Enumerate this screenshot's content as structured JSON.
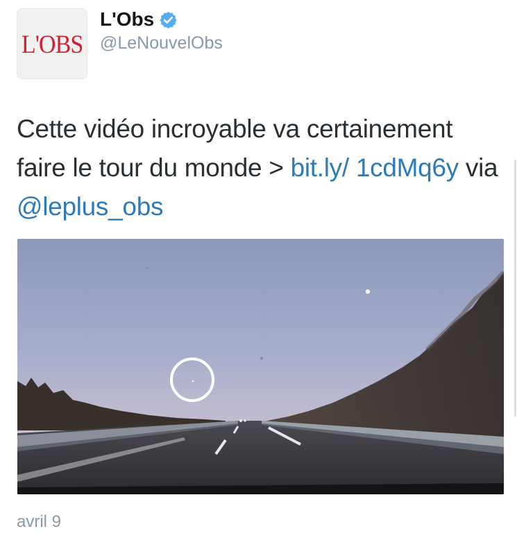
{
  "author": {
    "avatar_logo_text": "L'OBS",
    "display_name": "L'Obs",
    "verified_icon": "verified-check-icon",
    "handle": "@LeNouvelObs"
  },
  "tweet": {
    "text_before": "Cette vidéo incroyable va certainement faire le tour du monde > ",
    "link": "bit.ly/ 1cdMq6y",
    "text_via": " via ",
    "mention": "@leplus_obs",
    "timestamp": "avril 9"
  },
  "media": {
    "kind": "video-thumbnail",
    "icon": "highlight-circle"
  },
  "colors": {
    "brand_red": "#d1202f",
    "link_blue": "#2b7bb9",
    "verified_blue": "#55acee",
    "secondary_gray": "#8899a6",
    "text_dark": "#292f33"
  }
}
